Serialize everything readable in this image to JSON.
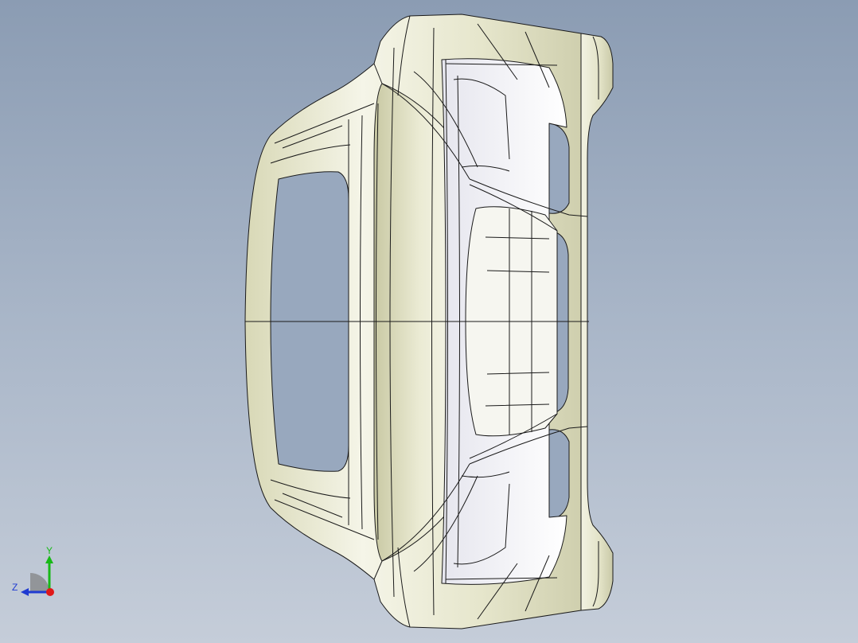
{
  "viewport": {
    "background_top": "#8b9cb3",
    "background_bottom": "#c5cdd9"
  },
  "model": {
    "icon": "car-body-wireframe",
    "surface_color": "#f3f3e4",
    "shade_color": "#d9d9b8",
    "edge_color": "#1a1a1a"
  },
  "triad": {
    "y_label": "Y",
    "z_label": "Z",
    "y_color": "#17b917",
    "z_color": "#1f3bd1",
    "x_color": "#e01818"
  }
}
